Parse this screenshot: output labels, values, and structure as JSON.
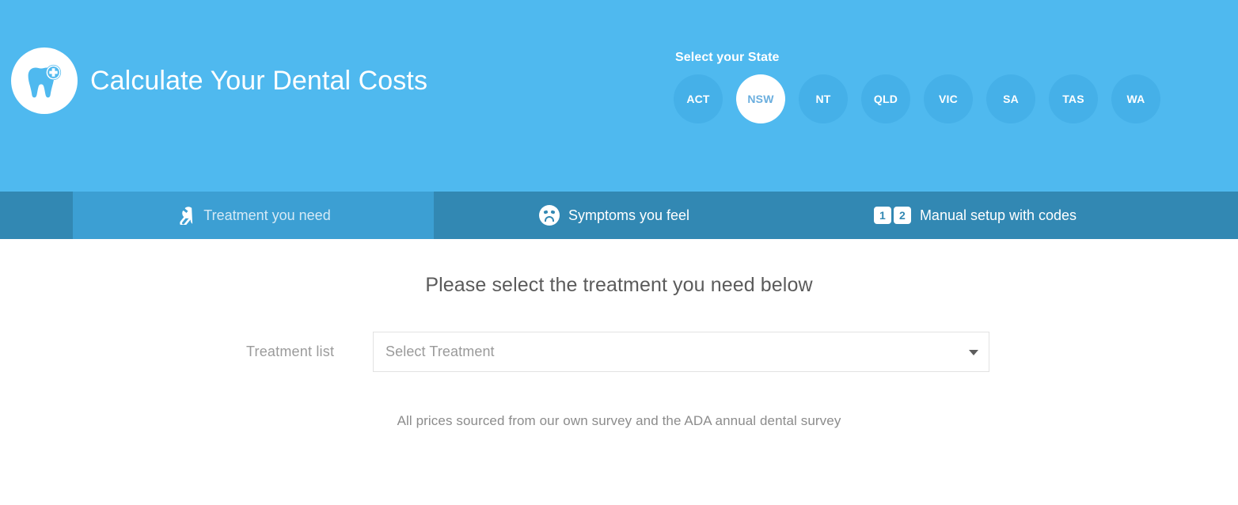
{
  "header": {
    "logo_icon": "tooth-plus-icon",
    "title": "Calculate Your Dental Costs",
    "state_picker": {
      "label": "Select your State",
      "selected": "NSW",
      "states": [
        {
          "code": "ACT"
        },
        {
          "code": "NSW"
        },
        {
          "code": "NT"
        },
        {
          "code": "QLD"
        },
        {
          "code": "VIC"
        },
        {
          "code": "SA"
        },
        {
          "code": "TAS"
        },
        {
          "code": "WA"
        }
      ]
    }
  },
  "tabs": [
    {
      "id": "treatment",
      "label": "Treatment you need",
      "icon": "wrench-icon",
      "active": true
    },
    {
      "id": "symptoms",
      "label": "Symptoms you feel",
      "icon": "sad-face-icon",
      "active": false
    },
    {
      "id": "manual",
      "label": "Manual setup with codes",
      "icon": "number-codes-icon",
      "digits": [
        "1",
        "2"
      ],
      "active": false
    }
  ],
  "main": {
    "heading": "Please select the treatment you need below",
    "form": {
      "label": "Treatment list",
      "select_value": "Select Treatment",
      "select_placeholder": "Select Treatment",
      "arrow_icon": "chevron-down-icon"
    },
    "note": "All prices sourced from our own survey and the ADA annual dental survey"
  },
  "colors": {
    "header_blue": "#4fb9ef",
    "state_btn_blue": "#45b0e8",
    "tabbar_blue": "#3288b3",
    "tab_active_blue": "#3c9fd3",
    "selected_state_text": "#6aaede",
    "body_text_gray": "#5b5b5b",
    "muted_gray": "#9b9b9b",
    "border_gray": "#e2e2e2"
  }
}
